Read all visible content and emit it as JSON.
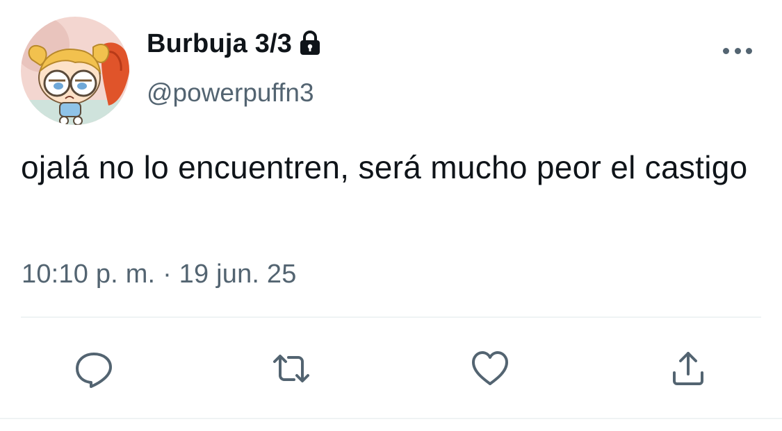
{
  "author": {
    "display_name": "Burbuja 3/3",
    "handle": "@powerpuffn3",
    "protected_icon": "lock-icon",
    "avatar": "cartoon-avatar"
  },
  "tweet": {
    "text": "ojalá no lo encuentren, será mucho peor el castigo",
    "timestamp": "10:10 p. m. · 19 jun. 25"
  },
  "actions": [
    {
      "icon": "reply-icon"
    },
    {
      "icon": "retweet-icon"
    },
    {
      "icon": "like-icon"
    },
    {
      "icon": "share-icon"
    }
  ],
  "more_icon": "more-options-icon",
  "colors": {
    "text_primary": "#0f1419",
    "text_secondary": "#536471",
    "divider": "#eff3f4",
    "background": "#ffffff"
  }
}
